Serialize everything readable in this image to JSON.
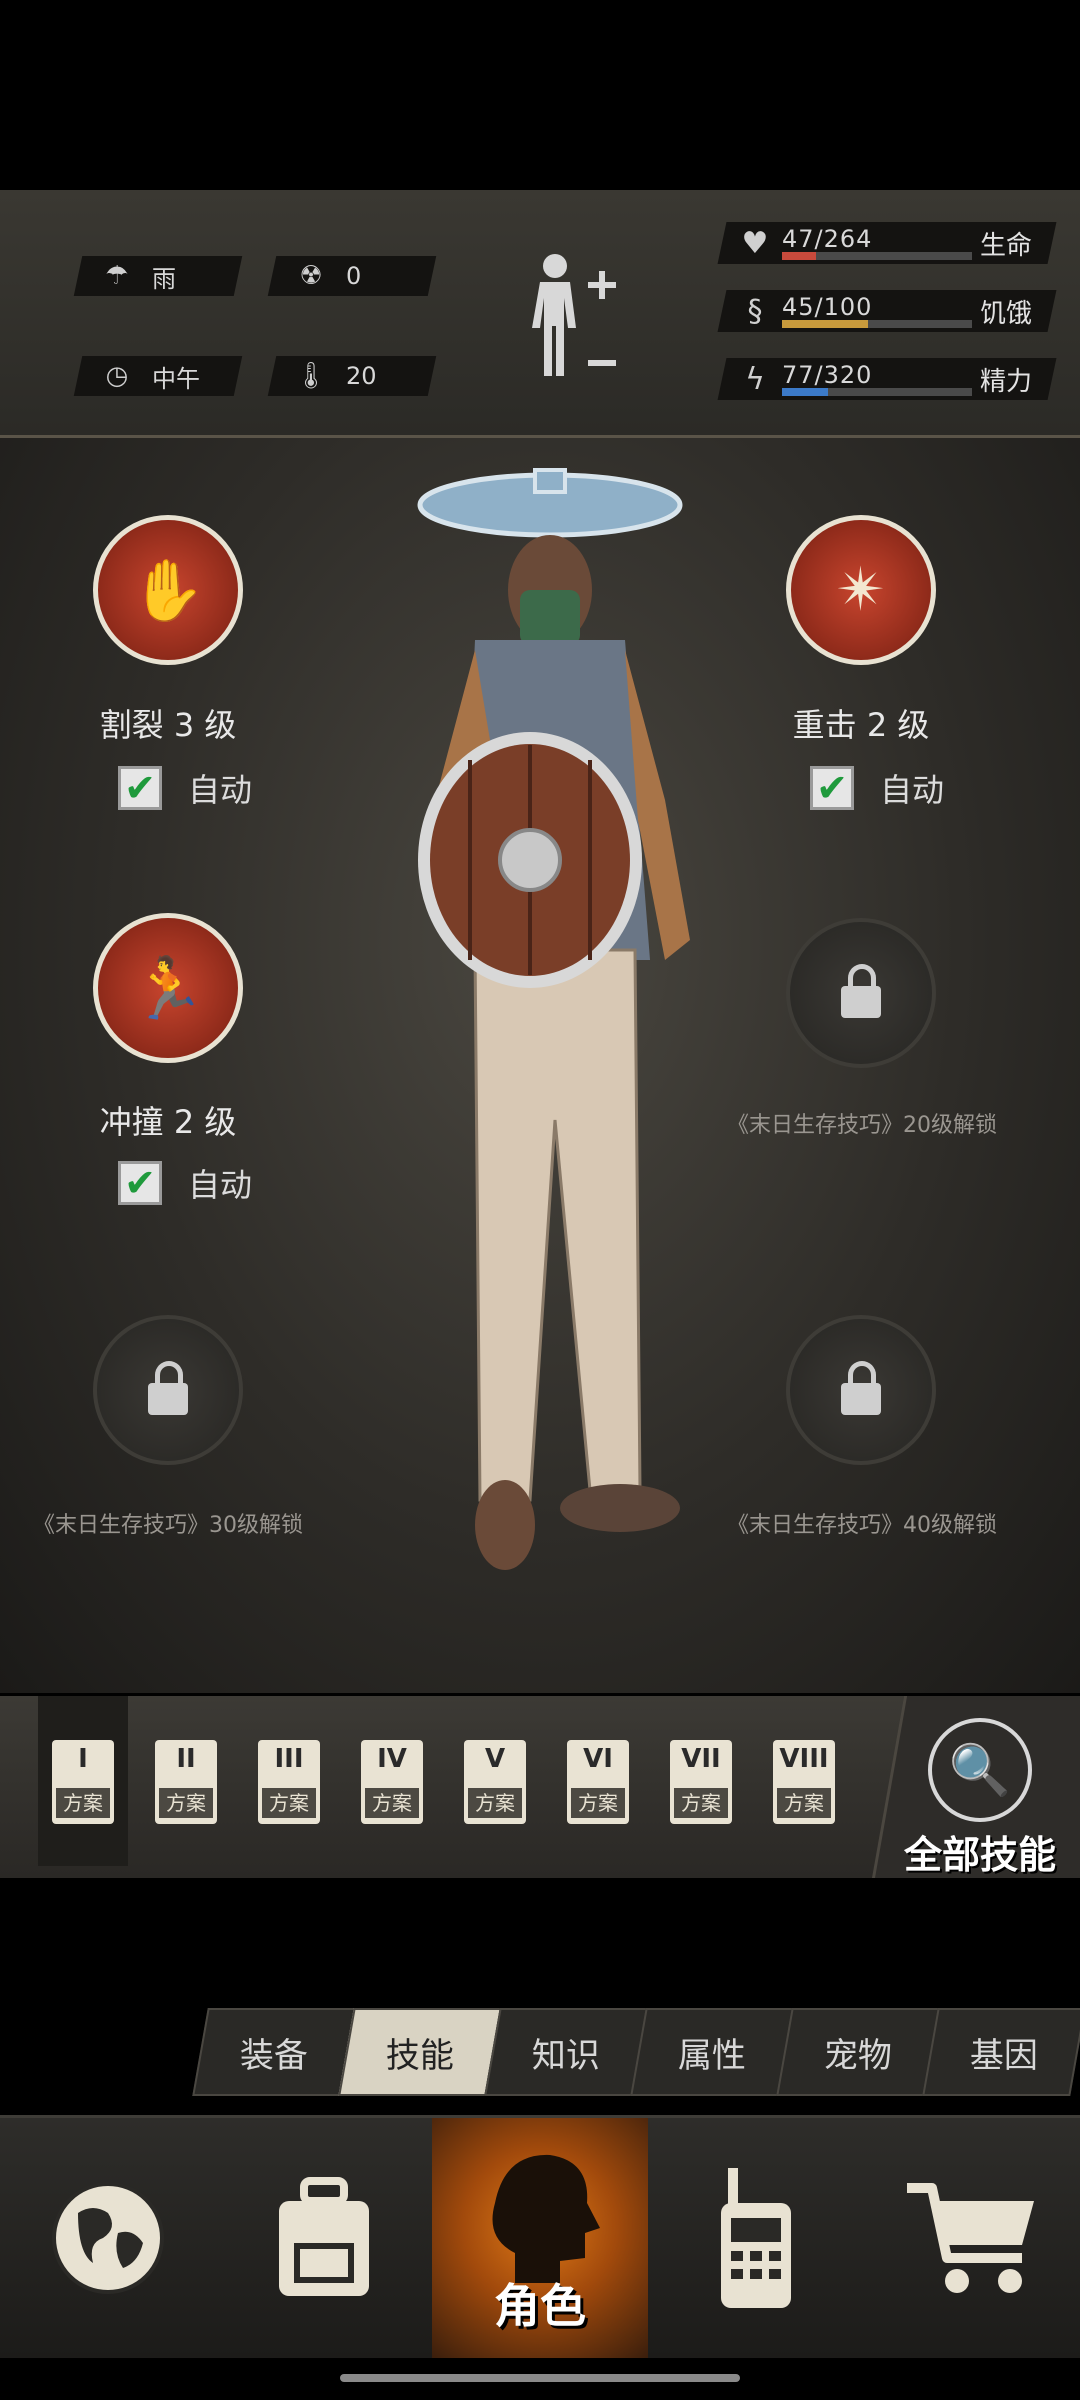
{
  "status": {
    "weather": "雨",
    "radiation": "0",
    "time": "中午",
    "temperature": "20",
    "stats": [
      {
        "label": "生命",
        "value": "47/264",
        "fraction": 0.178,
        "color": "#c84a3c",
        "icon": "heart-icon"
      },
      {
        "label": "饥饿",
        "value": "45/100",
        "fraction": 0.45,
        "color": "#c89a3c",
        "icon": "stomach-icon"
      },
      {
        "label": "精力",
        "value": "77/320",
        "fraction": 0.24,
        "color": "#3c7ac8",
        "icon": "energy-icon"
      }
    ]
  },
  "skills": {
    "s1": {
      "name": "割裂 3 级",
      "auto": "自动"
    },
    "s2": {
      "name": "重击 2 级",
      "auto": "自动"
    },
    "s3": {
      "name": "冲撞 2 级",
      "auto": "自动"
    },
    "lock1": "《末日生存技巧》20级解锁",
    "lock2": "《末日生存技巧》30级解锁",
    "lock3": "《末日生存技巧》40级解锁"
  },
  "plans": [
    {
      "num": "I",
      "label": "方案"
    },
    {
      "num": "II",
      "label": "方案"
    },
    {
      "num": "III",
      "label": "方案"
    },
    {
      "num": "IV",
      "label": "方案"
    },
    {
      "num": "V",
      "label": "方案"
    },
    {
      "num": "VI",
      "label": "方案"
    },
    {
      "num": "VII",
      "label": "方案"
    },
    {
      "num": "VIII",
      "label": "方案"
    }
  ],
  "all_skills": "全部技能",
  "tabs": [
    "装备",
    "技能",
    "知识",
    "属性",
    "宠物",
    "基因"
  ],
  "active_tab": "技能",
  "nav": {
    "active_label": "角色"
  }
}
